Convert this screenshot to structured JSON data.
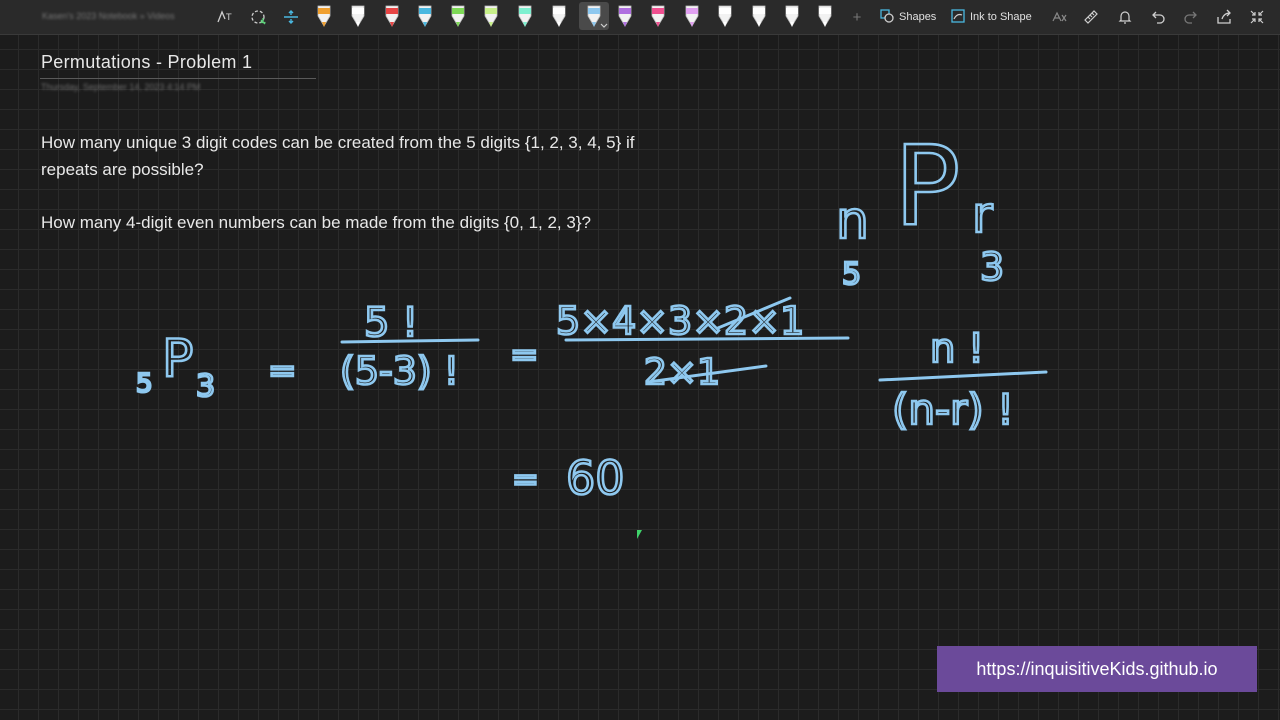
{
  "toolbar": {
    "breadcrumb": "Kasen's 2023 Notebook » Videos",
    "shapes_label": "Shapes",
    "ink_to_shape_label": "Ink to Shape",
    "pens": [
      {
        "color": "#f0a030"
      },
      {
        "color": "#ffffff"
      },
      {
        "color": "#e84545"
      },
      {
        "color": "#4ab8e0"
      },
      {
        "color": "#7ed957"
      },
      {
        "color": "#c8f08a"
      },
      {
        "color": "#7ef0d0"
      },
      {
        "color": "#ffffff"
      },
      {
        "color": "#8ec8ef"
      },
      {
        "color": "#b070e0"
      },
      {
        "color": "#f05090"
      },
      {
        "color": "#e0a0f0"
      },
      {
        "color": "#ffffff"
      },
      {
        "color": "#ffffff"
      },
      {
        "color": "#ffffff"
      },
      {
        "color": "#ffffff"
      }
    ]
  },
  "page": {
    "title": "Permutations - Problem 1",
    "date": "Thursday, September 14, 2023      4:14 PM",
    "question1": "How many unique 3 digit codes can be created from the 5 digits {1, 2, 3, 4, 5} if repeats are possible?",
    "question2": "How many 4-digit even numbers can be made from the digits {0, 1, 2, 3}?"
  },
  "ink": {
    "equals": "=",
    "result": "60",
    "p": "P",
    "n": "n",
    "r": "r",
    "five": "5",
    "three": "3",
    "fact_num": "5 !",
    "fact_den": "(5-3) !",
    "expand_num": "5×4×3×2×1",
    "expand_den": "2×1",
    "formula_num": "n !",
    "formula_den": "(n-r) !"
  },
  "watermark": "https://inquisitiveKids.github.io",
  "colors": {
    "ink": "#8ec8ef",
    "watermark_bg": "#6b4a9a"
  }
}
